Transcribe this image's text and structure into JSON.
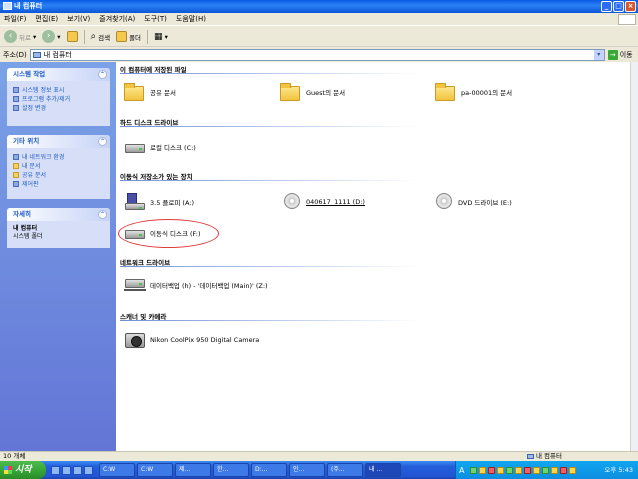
{
  "window": {
    "title": "내 컴퓨터"
  },
  "menu": [
    "파일(F)",
    "편집(E)",
    "보기(V)",
    "즐겨찾기(A)",
    "도구(T)",
    "도움말(H)"
  ],
  "toolbar": {
    "back": "뒤로",
    "search": "검색",
    "folders": "폴더"
  },
  "address": {
    "label": "주소(D)",
    "value": "내 컴퓨터",
    "go": "이동"
  },
  "sidebar": {
    "system_tasks": {
      "title": "시스템 작업",
      "items": [
        "시스템 정보 표시",
        "프로그램 추가/제거",
        "설정 변경"
      ]
    },
    "other_places": {
      "title": "기타 위치",
      "items": [
        "내 네트워크 환경",
        "내 문서",
        "공유 문서",
        "제어판"
      ]
    },
    "details": {
      "title": "자세히",
      "name": "내 컴퓨터",
      "type": "시스템 폴더"
    }
  },
  "groups": {
    "stored": "이 컴퓨터에 저장된 파일",
    "hdd": "하드 디스크 드라이브",
    "removable": "이동식 저장소가 있는 장치",
    "network": "네트워크 드라이브",
    "scanners": "스캐너 및 카메라"
  },
  "items": {
    "shared_docs": "공유 문서",
    "guest_docs": "Guest의 문서",
    "pa_docs": "pa-00001의 문서",
    "local_disk": "로컬 디스크 (C:)",
    "floppy": "3.5 플로피 (A:)",
    "cd": "040617_1111 (D:)",
    "dvd": "DVD 드라이브 (E:)",
    "removable_disk": "이동식 디스크 (F:)",
    "net_drive": "데이터백업 (h) - '데이터백업 (Main)' (Z:)",
    "camera": "Nikon CoolPix 950 Digital Camera"
  },
  "status": {
    "count": "10 개체",
    "location": "내 컴퓨터"
  },
  "taskbar": {
    "start": "시작",
    "tasks": [
      "C:W",
      "C:W",
      "제...",
      "한...",
      "D:...",
      "인...",
      "(주...",
      "내 ..."
    ],
    "language": "A",
    "clock": "오후 5:43"
  },
  "colors": {
    "accent": "#215dc6",
    "highlight_circle": "#e23a3a"
  }
}
